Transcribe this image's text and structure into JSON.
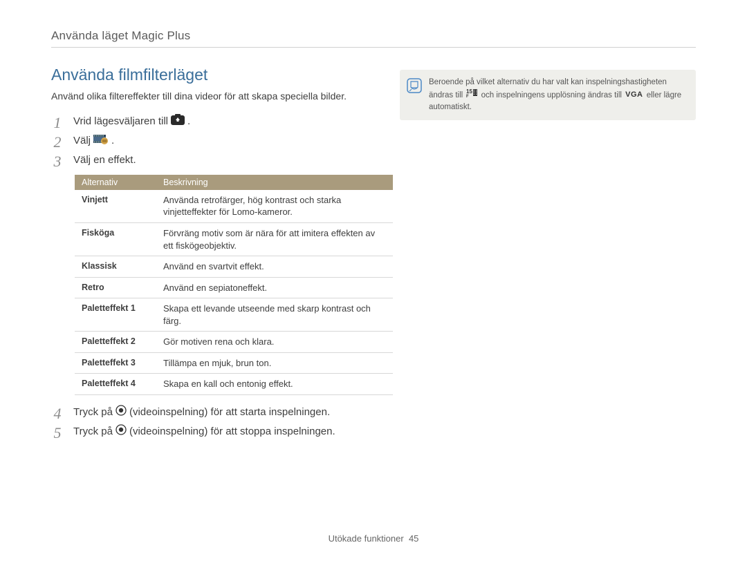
{
  "section_label": "Använda läget Magic Plus",
  "left": {
    "heading": "Använda filmfilterläget",
    "intro": "Använd olika filtereffekter till dina videor för att skapa speciella bilder.",
    "steps": {
      "s1": "Vrid lägesväljaren till",
      "s1_suffix": ".",
      "s2_prefix": "Välj",
      "s2_suffix": ".",
      "s3": "Välj en effekt.",
      "s4_a": "Tryck på",
      "s4_b": "(videoinspelning) för att starta inspelningen.",
      "s5_a": "Tryck på",
      "s5_b": "(videoinspelning) för att stoppa inspelningen."
    },
    "table": {
      "col_option": "Alternativ",
      "col_desc": "Beskrivning",
      "rows": [
        {
          "opt": "Vinjett",
          "desc": "Använda retrofärger, hög kontrast och starka vinjetteffekter för Lomo-kameror."
        },
        {
          "opt": "Fisköga",
          "desc": "Förvräng motiv som är nära för att imitera effekten av ett fiskögeobjektiv."
        },
        {
          "opt": "Klassisk",
          "desc": "Använd en svartvit effekt."
        },
        {
          "opt": "Retro",
          "desc": "Använd en sepiatoneffekt."
        },
        {
          "opt": "Paletteffekt 1",
          "desc": "Skapa ett levande utseende med skarp kontrast och färg."
        },
        {
          "opt": "Paletteffekt 2",
          "desc": "Gör motiven rena och klara."
        },
        {
          "opt": "Paletteffekt 3",
          "desc": "Tillämpa en mjuk, brun ton."
        },
        {
          "opt": "Paletteffekt 4",
          "desc": "Skapa en kall och entonig effekt."
        }
      ]
    }
  },
  "right": {
    "note_a": "Beroende på vilket alternativ du har valt kan inspelningshastigheten ändras till",
    "note_b": "och inspelningens upplösning ändras till",
    "note_c": "eller lägre automatiskt.",
    "vga": "VGA",
    "fps_value": "15",
    "fps_unit": "F"
  },
  "footer": {
    "section": "Utökade funktioner",
    "page": "45"
  }
}
